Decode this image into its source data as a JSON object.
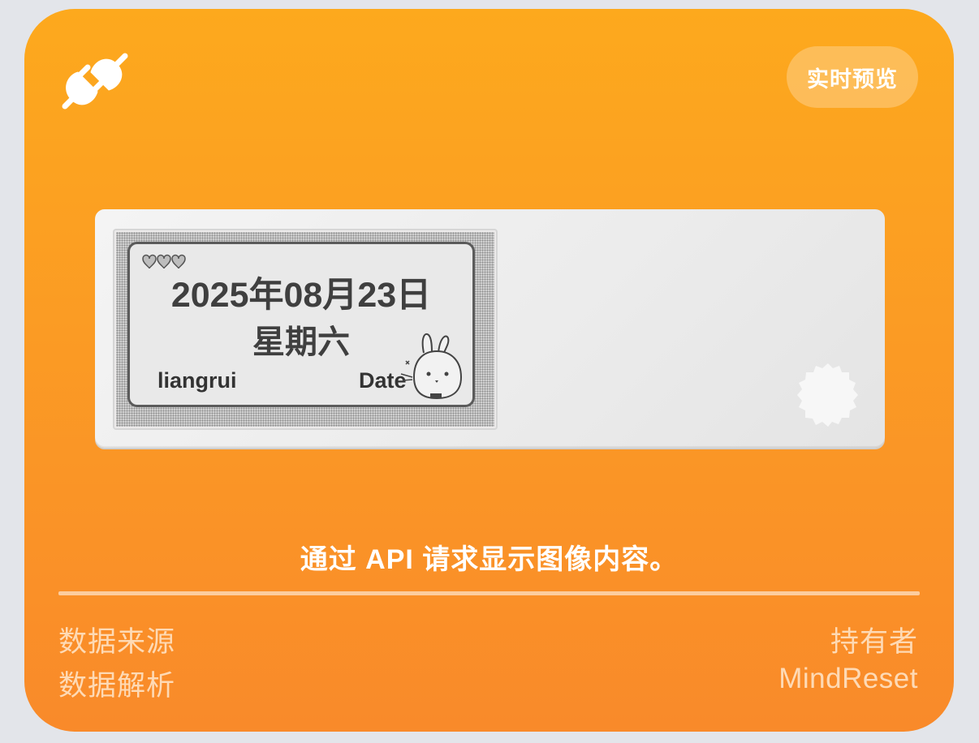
{
  "header": {
    "icon": "plug-icon",
    "preview_button_label": "实时预览"
  },
  "device_preview": {
    "screen": {
      "date_text": "2025年08月23日",
      "weekday_text": "星期六",
      "username": "liangrui",
      "label": "Date"
    }
  },
  "description": "通过 API 请求显示图像内容。",
  "meta": {
    "source_label": "数据来源",
    "parse_label": "数据解析",
    "owner_label": "持有者",
    "owner_value": "MindReset"
  },
  "colors": {
    "card_top": "#fda91d",
    "card_bottom": "#f98a2a",
    "background": "#e3e5ea"
  }
}
